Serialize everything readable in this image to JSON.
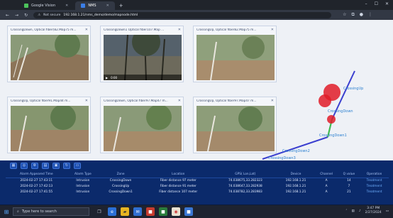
{
  "browser": {
    "tabs": [
      {
        "label": "Google Vision",
        "active": false
      },
      {
        "label": "NMS",
        "active": true
      }
    ],
    "security_label": "Not secure",
    "url": "192.168.1.21/nms_demo/demo/mapnode.html"
  },
  "thumbnails": [
    {
      "title": "CrossingDown, Optical fiber(82.Map75 m..."
    },
    {
      "title": "CrossingDown1 Optical fiber107.Map ..."
    },
    {
      "title": "CrossingUp, Optical fiber82.Map75 m..."
    },
    {
      "title": "CrossingUp, Optical fiber91.Map44 m..."
    },
    {
      "title": "CrossingDown, Optical fiber97.Map47 m..."
    },
    {
      "title": "CrossingUp, Optical fiber97.Map47 m..."
    }
  ],
  "video": {
    "time": "0:00"
  },
  "map_labels": {
    "crossing_up": "CrossingUp",
    "crossing_down": "CrossingDown",
    "crossing_down1": "CrossingDown1",
    "crossing_down2": "CrossingDown2",
    "crossing_down3": "CrossingDown3"
  },
  "table": {
    "headers": [
      "Alarm Appeared Time",
      "Alarm Type",
      "Zone",
      "Location",
      "GPS( Lon,Lat)",
      "Device",
      "Channel",
      "Q value",
      "Operation"
    ],
    "rows": [
      [
        "2024-02-27 17:43:11",
        "Intrusion",
        "CrossingDown",
        "Fiber distance 97 meter",
        "74.038675,33.282323",
        "192.168.1.21",
        "A",
        "14",
        "Treatment"
      ],
      [
        "2024-02-27 17:42:13",
        "Intrusion",
        "CrossingUp",
        "Fiber distance 91 meter",
        "74.038647,33.282938",
        "192.168.1.21",
        "A",
        "7",
        "Treatment"
      ],
      [
        "2024-02-27 17:41:55",
        "Intrusion",
        "CrossingDown1",
        "Fiber distance 107 meter",
        "74.038782,33.283983",
        "192.168.1.21",
        "A",
        "21",
        "Treatment"
      ]
    ]
  },
  "taskbar": {
    "search_placeholder": "Type here to search",
    "time": "3:47 PM",
    "date": "2/27/2024"
  },
  "colors": {
    "app_bg": "#0b2a6b",
    "fiber_line": "#3b3fcf",
    "alarm": "#e01c28",
    "map_label": "#2a7fd0"
  }
}
